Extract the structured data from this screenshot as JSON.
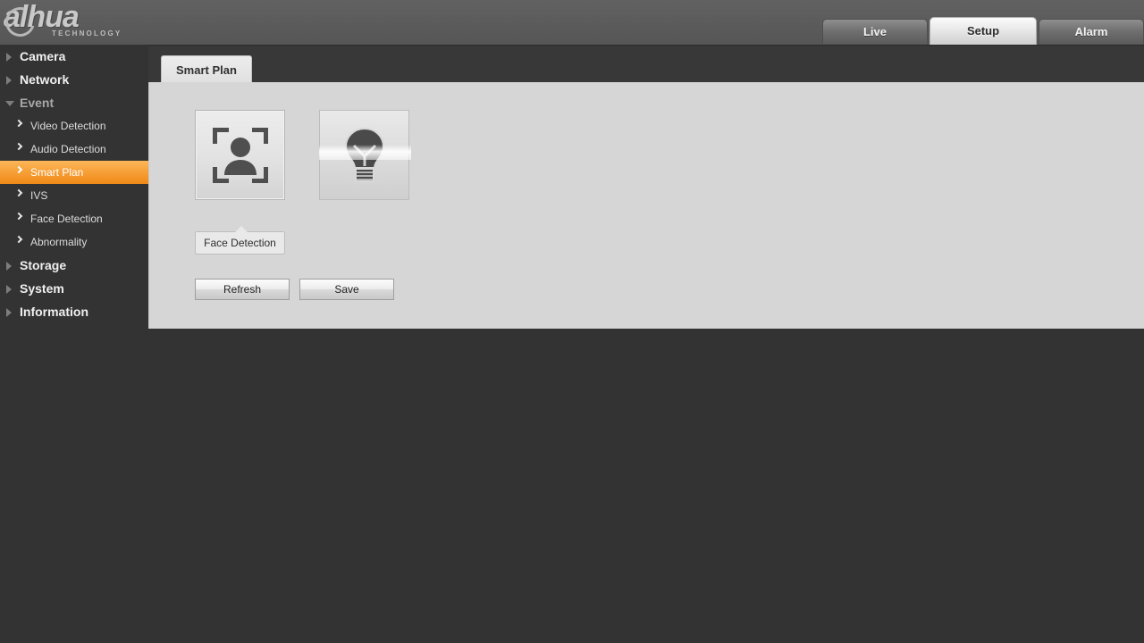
{
  "header": {
    "logo_text": "alhua",
    "logo_subtitle": "TECHNOLOGY",
    "tabs": [
      {
        "label": "Live",
        "active": false
      },
      {
        "label": "Setup",
        "active": true
      },
      {
        "label": "Alarm",
        "active": false
      }
    ]
  },
  "sidebar": {
    "items": [
      {
        "label": "Camera",
        "type": "top",
        "expanded": false
      },
      {
        "label": "Network",
        "type": "top",
        "expanded": false
      },
      {
        "label": "Event",
        "type": "top",
        "expanded": true
      },
      {
        "label": "Video Detection",
        "type": "sub",
        "selected": false
      },
      {
        "label": "Audio Detection",
        "type": "sub",
        "selected": false
      },
      {
        "label": "Smart Plan",
        "type": "sub",
        "selected": true
      },
      {
        "label": "IVS",
        "type": "sub",
        "selected": false
      },
      {
        "label": "Face Detection",
        "type": "sub",
        "selected": false
      },
      {
        "label": "Abnormality",
        "type": "sub",
        "selected": false
      },
      {
        "label": "Storage",
        "type": "top",
        "expanded": false
      },
      {
        "label": "System",
        "type": "top",
        "expanded": false
      },
      {
        "label": "Information",
        "type": "top",
        "expanded": false
      }
    ]
  },
  "main": {
    "tab_label": "Smart Plan",
    "plans": [
      {
        "icon": "face-detection-icon",
        "state": "selected"
      },
      {
        "icon": "lightbulb-ivs-icon",
        "state": "unselected"
      }
    ],
    "selected_plan_label": "Face Detection",
    "buttons": {
      "refresh": "Refresh",
      "save": "Save"
    }
  },
  "colors": {
    "accent": "#f7a13a",
    "header_bg": "#5b5b5b",
    "body_bg": "#333333",
    "panel_bg": "#d6d6d6"
  }
}
